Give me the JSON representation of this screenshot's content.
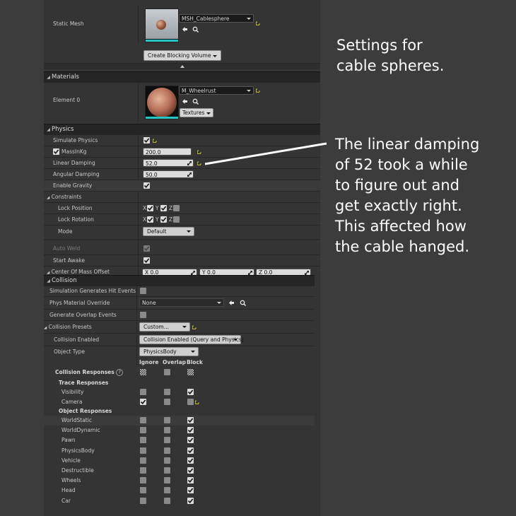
{
  "static_mesh": {
    "label": "Static Mesh",
    "asset": "MSH_Cablesphere",
    "button": "Create Blocking Volume"
  },
  "materials": {
    "header": "Materials",
    "element_label": "Element 0",
    "asset": "M_Wheelrust",
    "textures_button": "Textures"
  },
  "physics": {
    "header": "Physics",
    "simulate": "Simulate Physics",
    "mass_label": "MassInKg",
    "mass_value": "200.0",
    "linear_label": "Linear Damping",
    "linear_value": "52.0",
    "angular_label": "Angular Damping",
    "angular_value": "50.0",
    "gravity": "Enable Gravity",
    "constraints": "Constraints",
    "lock_position": "Lock Position",
    "lock_rotation": "Lock Rotation",
    "mode_label": "Mode",
    "mode_value": "Default",
    "auto_weld": "Auto Weld",
    "start_awake": "Start Awake",
    "com_label": "Center Of Mass Offset",
    "com_x": "X  0.0",
    "com_y": "Y  0.0",
    "com_z": "Z  0.0",
    "axis_x": "X",
    "axis_y": "Y",
    "axis_z": "Z"
  },
  "collision": {
    "header": "Collision",
    "hit_events": "Simulation Generates Hit Events",
    "phys_material": "Phys Material Override",
    "phys_material_value": "None",
    "overlap_events": "Generate Overlap Events",
    "presets_label": "Collision Presets",
    "presets_value": "Custom...",
    "enabled_label": "Collision Enabled",
    "enabled_value": "Collision Enabled (Query and Physics)",
    "object_type_label": "Object Type",
    "object_type_value": "PhysicsBody",
    "col_ignore": "Ignore",
    "col_overlap": "Overlap",
    "col_block": "Block",
    "responses_label": "Collision Responses",
    "trace_label": "Trace Responses",
    "object_label": "Object Responses",
    "trace_rows": [
      {
        "label": "Visibility"
      },
      {
        "label": "Camera"
      }
    ],
    "object_rows": [
      {
        "label": "WorldStatic"
      },
      {
        "label": "WorldDynamic"
      },
      {
        "label": "Pawn"
      },
      {
        "label": "PhysicsBody"
      },
      {
        "label": "Vehicle"
      },
      {
        "label": "Destructible"
      },
      {
        "label": "Wheels"
      },
      {
        "label": "Head"
      },
      {
        "label": "Car"
      }
    ]
  },
  "annotations": {
    "note1_line1": "Settings for",
    "note1_line2": "cable spheres.",
    "note2_lines": [
      "The linear damping",
      "of 52 took a while",
      "to figure out and",
      "get exactly right.",
      "This affected how",
      "the cable hanged."
    ]
  },
  "colors": {
    "background": "#3c3c3c",
    "panel": "#343434",
    "header": "#252525",
    "reset_arrow": "#c7c12a",
    "annotation_text": "#ffffff"
  }
}
